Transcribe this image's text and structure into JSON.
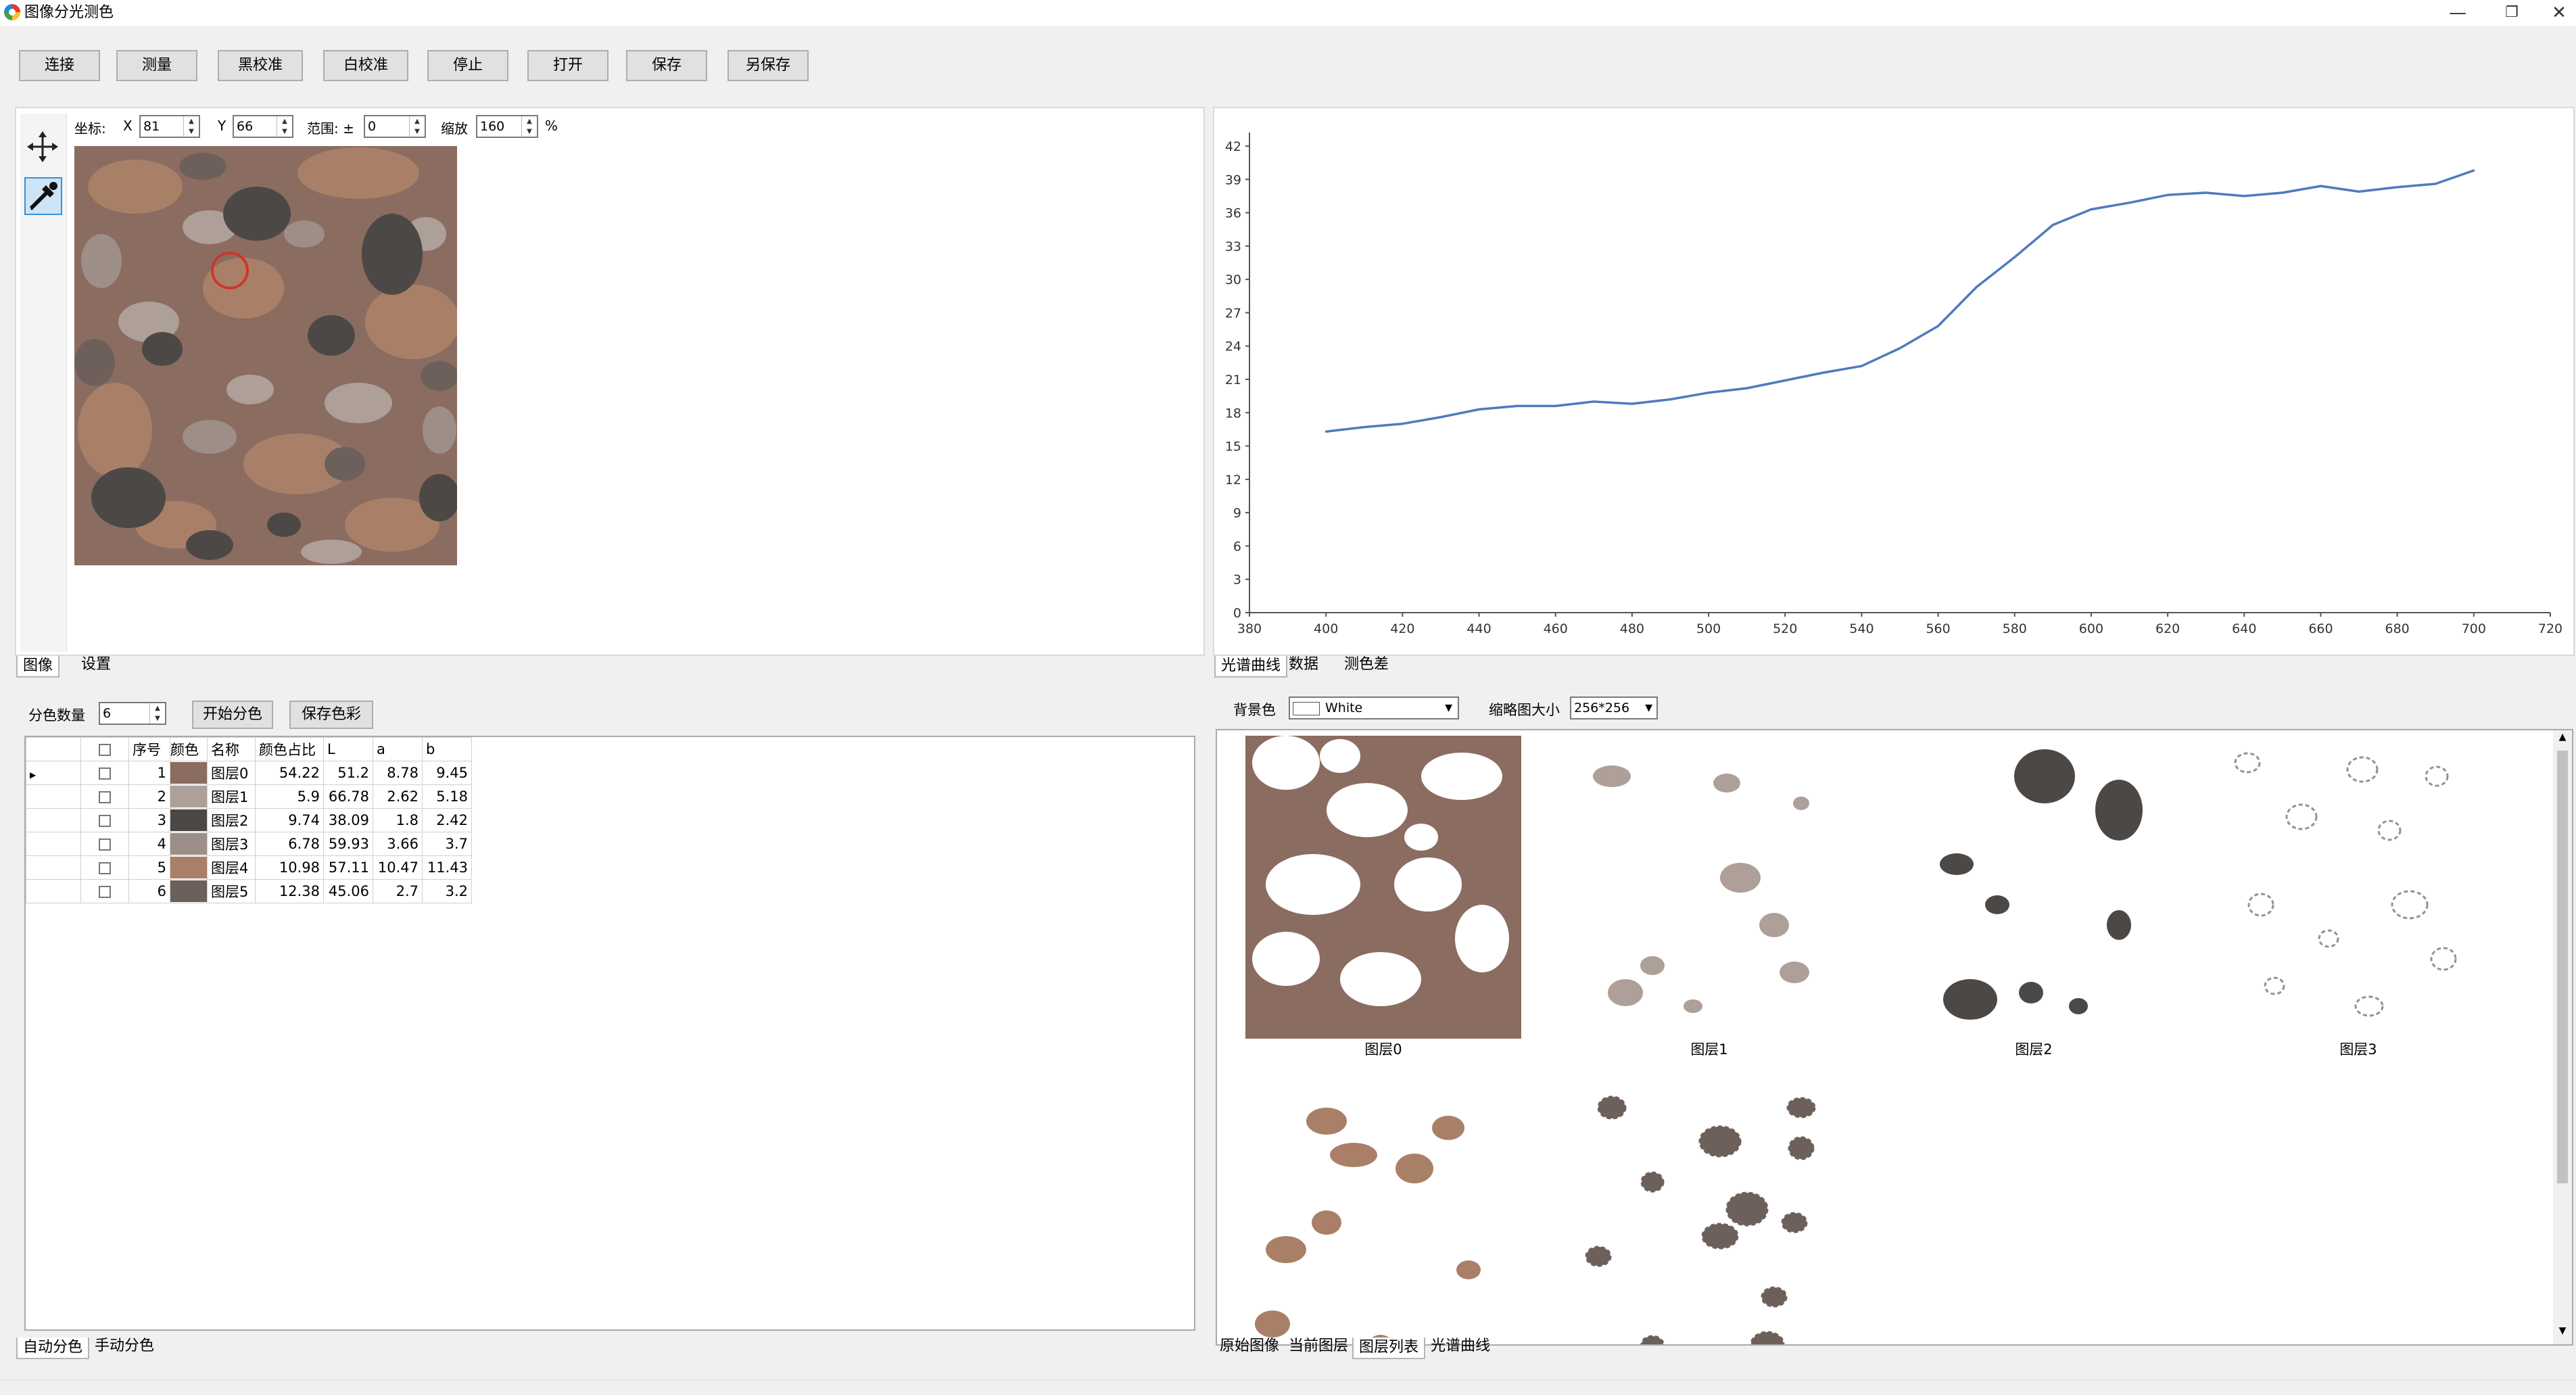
{
  "window": {
    "title": "图像分光测色"
  },
  "toolbar": {
    "buttons": [
      "连接",
      "测量",
      "黑校准",
      "白校准",
      "停止",
      "打开",
      "保存",
      "另保存"
    ]
  },
  "image_panel": {
    "coord_label": "坐标:",
    "x_label": "X",
    "x_value": "81",
    "y_label": "Y",
    "y_value": "66",
    "range_label": "范围: ±",
    "range_value": "0",
    "zoom_label": "缩放",
    "zoom_value": "160",
    "zoom_unit": "%",
    "tabs": [
      "图像",
      "设置"
    ],
    "active_tab": 0
  },
  "chart_panel": {
    "tabs": [
      "光谱曲线",
      "数据",
      "测色差"
    ],
    "active_tab": 0
  },
  "chart_data": {
    "type": "line",
    "x": [
      400,
      410,
      420,
      430,
      440,
      450,
      460,
      470,
      480,
      490,
      500,
      510,
      520,
      530,
      540,
      550,
      560,
      570,
      580,
      590,
      600,
      610,
      620,
      630,
      640,
      650,
      660,
      670,
      680,
      690,
      700
    ],
    "series": [
      {
        "values": [
          16.3,
          16.7,
          17.0,
          17.6,
          18.3,
          18.6,
          18.6,
          19.0,
          18.8,
          19.2,
          19.8,
          20.2,
          20.9,
          21.6,
          22.2,
          23.8,
          25.8,
          29.3,
          32.0,
          34.9,
          36.3,
          36.9,
          37.6,
          37.8,
          37.5,
          37.8,
          38.4,
          37.9,
          38.3,
          38.6,
          39.8
        ]
      }
    ],
    "xlim": [
      380,
      720
    ],
    "ylim": [
      0,
      42
    ],
    "xticks": [
      380,
      400,
      420,
      440,
      460,
      480,
      500,
      520,
      540,
      560,
      580,
      600,
      620,
      640,
      660,
      680,
      700,
      720
    ],
    "yticks": [
      0,
      3,
      6,
      9,
      12,
      15,
      18,
      21,
      24,
      27,
      30,
      33,
      36,
      39,
      42
    ],
    "line_color": "#4f7bbd",
    "grid": false
  },
  "separation": {
    "count_label": "分色数量",
    "count_value": "6",
    "start_button": "开始分色",
    "save_button": "保存色彩",
    "headers": [
      "序号",
      "颜色",
      "名称",
      "颜色占比",
      "L",
      "a",
      "b"
    ],
    "rows": [
      {
        "idx": "1",
        "color": "#8b6c61",
        "name": "图层0",
        "ratio": "54.22",
        "L": "51.2",
        "a": "8.78",
        "b": "9.45"
      },
      {
        "idx": "2",
        "color": "#ae9f98",
        "name": "图层1",
        "ratio": "5.9",
        "L": "66.78",
        "a": "2.62",
        "b": "5.18"
      },
      {
        "idx": "3",
        "color": "#4c4846",
        "name": "图层2",
        "ratio": "9.74",
        "L": "38.09",
        "a": "1.8",
        "b": "2.42"
      },
      {
        "idx": "4",
        "color": "#9e8e88",
        "name": "图层3",
        "ratio": "6.78",
        "L": "59.93",
        "a": "3.66",
        "b": "3.7"
      },
      {
        "idx": "5",
        "color": "#a98067",
        "name": "图层4",
        "ratio": "10.98",
        "L": "57.11",
        "a": "10.47",
        "b": "11.43"
      },
      {
        "idx": "6",
        "color": "#6d605b",
        "name": "图层5",
        "ratio": "12.38",
        "L": "45.06",
        "a": "2.7",
        "b": "3.2"
      }
    ],
    "tabs": [
      "自动分色",
      "手动分色"
    ],
    "active_tab": 0
  },
  "layers_panel": {
    "bg_label": "背景色",
    "bg_value": "White",
    "thumb_label": "缩略图大小",
    "thumb_value": "256*256",
    "layers": [
      "图层0",
      "图层1",
      "图层2",
      "图层3",
      "图层4",
      "图层5"
    ],
    "layer_colors": [
      "#8b6c61",
      "#ae9f98",
      "#4c4846",
      "#9e8e88",
      "#a98067",
      "#6d605b"
    ],
    "tabs": [
      "原始图像",
      "当前图层",
      "图层列表",
      "光谱曲线"
    ],
    "active_tab": 2
  }
}
